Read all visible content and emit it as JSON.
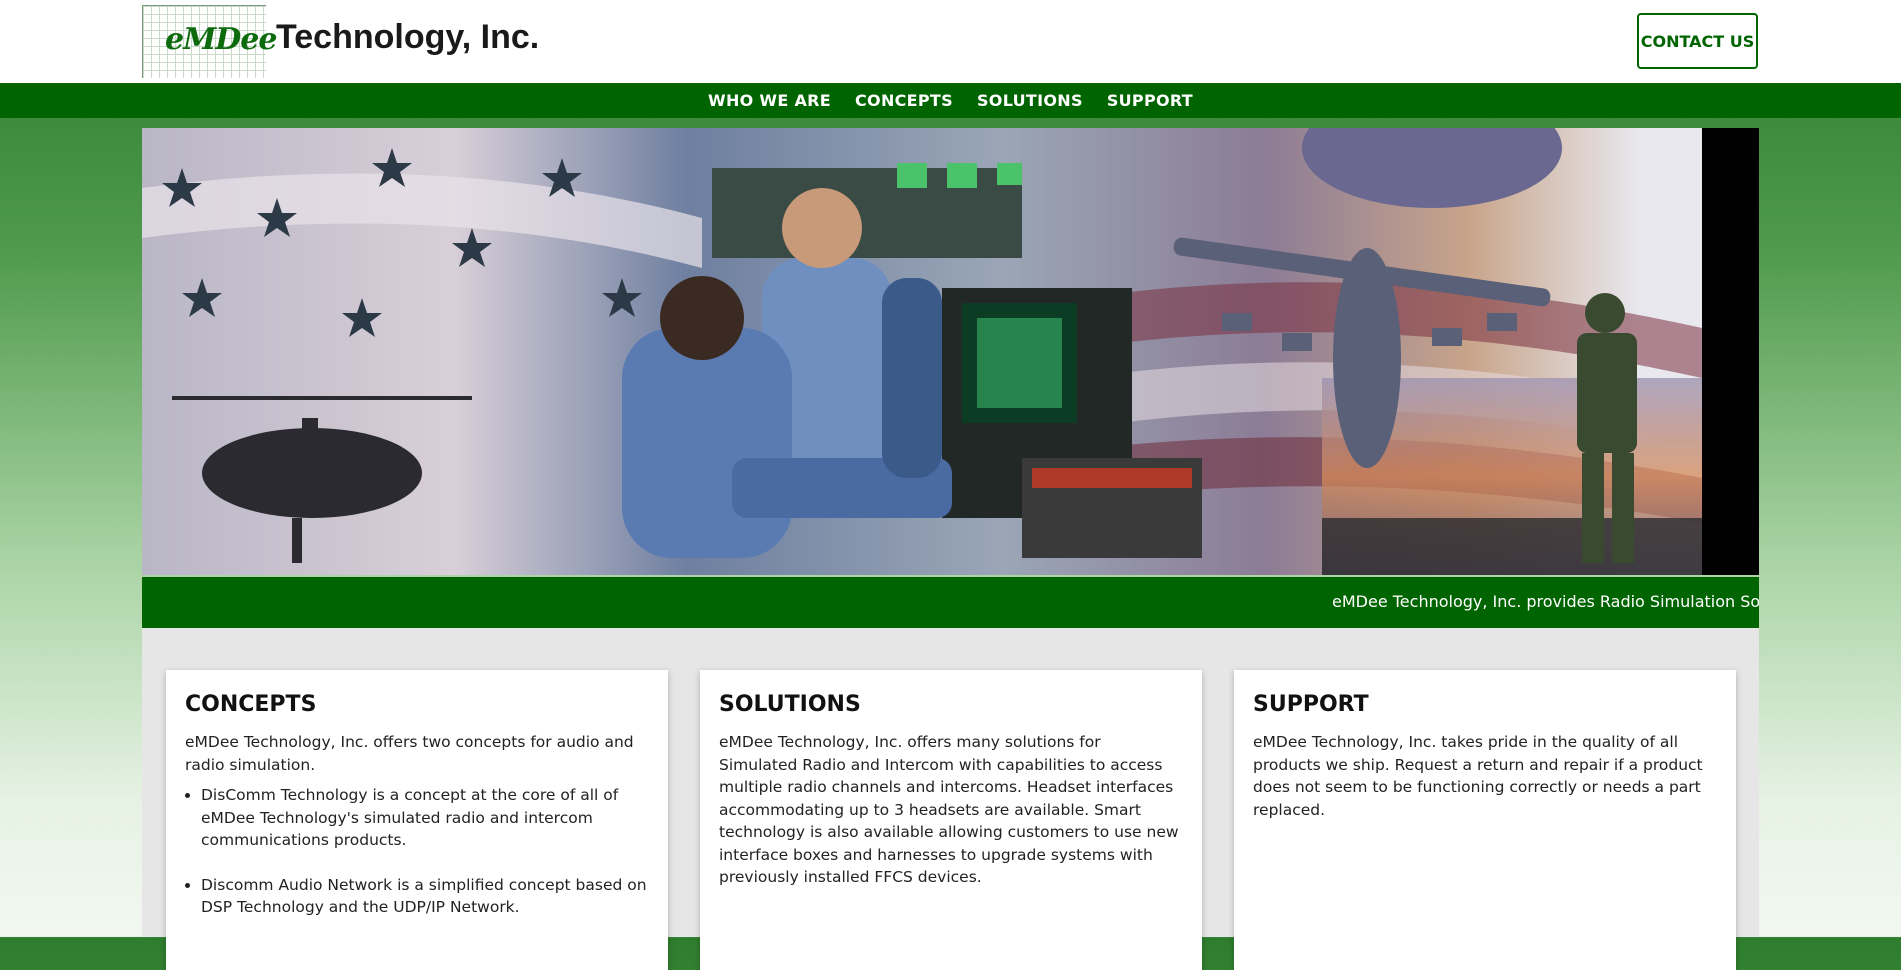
{
  "header": {
    "logo_script": "eMDee",
    "logo_text": "Technology, Inc.",
    "contact_label": "CONTACT US"
  },
  "nav": {
    "items": [
      {
        "label": "WHO WE ARE"
      },
      {
        "label": "CONCEPTS"
      },
      {
        "label": "SOLUTIONS"
      },
      {
        "label": "SUPPORT"
      }
    ]
  },
  "ticker": {
    "text": "eMDee Technology, Inc. provides Radio Simulation Softw"
  },
  "cards": [
    {
      "title": "CONCEPTS",
      "body": "eMDee Technology, Inc. offers two concepts for audio and radio simulation.",
      "bullets": [
        "DisComm Technology is a concept at the core of all of eMDee Technology's simulated radio and intercom communications products.",
        "Discomm Audio Network is a simplified concept based on DSP Technology and the UDP/IP Network."
      ]
    },
    {
      "title": "SOLUTIONS",
      "body": "eMDee Technology, Inc. offers many solutions for Simulated Radio and Intercom with capabilities to access multiple radio channels and intercoms. Headset interfaces accommodating up to 3 headsets are available. Smart technology is also available allowing customers to use new interface boxes and harnesses to upgrade systems with previously installed FFCS devices."
    },
    {
      "title": "SUPPORT",
      "body": "eMDee Technology, Inc. takes pride in the quality of all products we ship. Request a return and repair if a product does not seem to be functioning correctly or needs a part replaced."
    }
  ],
  "colors": {
    "brand_green": "#006400",
    "content_bg": "#e6e6e6"
  }
}
